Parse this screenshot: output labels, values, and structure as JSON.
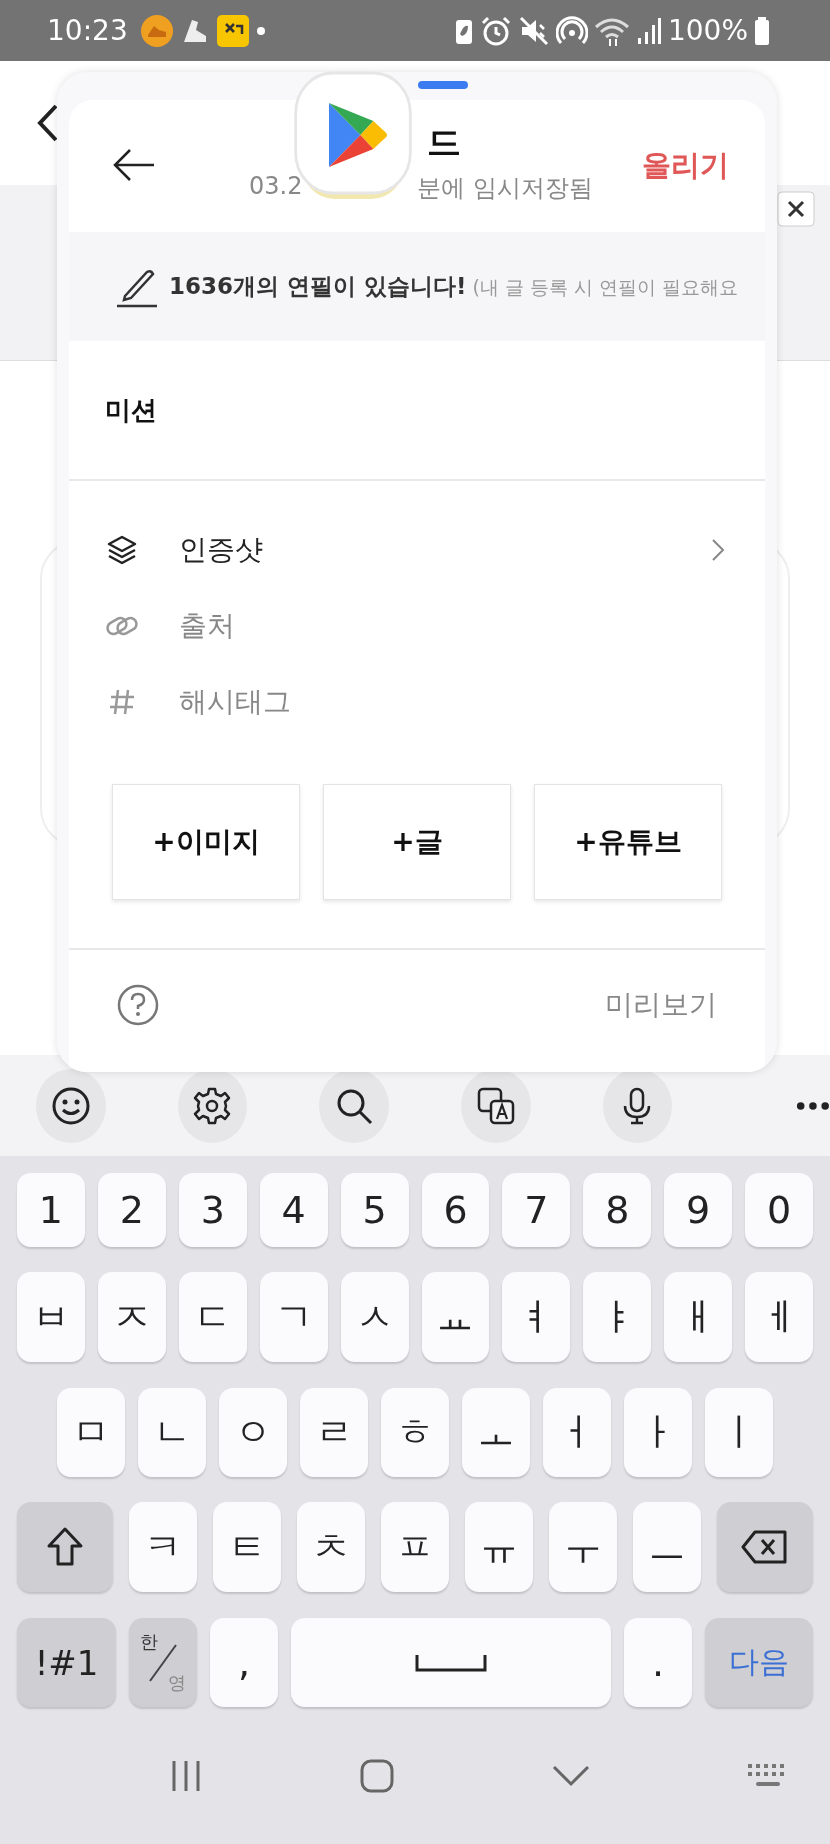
{
  "status_bar": {
    "time": "10:23",
    "battery": "100%"
  },
  "editor": {
    "title": "드",
    "saved_parts": [
      "03.2",
      "분에 임시저장됨"
    ],
    "submit": "올리기",
    "notice": "**1636개의 연필이 있습니다!** (내 글 등록 시 연필이 필요해요",
    "mission_label": "미션",
    "rows": [
      {
        "kind": "link",
        "label": "인증샷"
      },
      {
        "kind": "input",
        "label": "출처"
      },
      {
        "kind": "input",
        "label": "해시태그"
      }
    ],
    "add_buttons": [
      "+이미지",
      "+글",
      "+유튜브"
    ],
    "preview": "미리보기"
  },
  "keyboard": {
    "rows": [
      {
        "keys": [
          {
            "kind": "char",
            "label": "1"
          },
          {
            "kind": "char",
            "label": "2"
          },
          {
            "kind": "char",
            "label": "3"
          },
          {
            "kind": "char",
            "label": "4"
          },
          {
            "kind": "char",
            "label": "5"
          },
          {
            "kind": "char",
            "label": "6"
          },
          {
            "kind": "char",
            "label": "7"
          },
          {
            "kind": "char",
            "label": "8"
          },
          {
            "kind": "char",
            "label": "9"
          },
          {
            "kind": "char",
            "label": "0"
          }
        ]
      },
      {
        "keys": [
          {
            "kind": "char",
            "label": "ㅂ"
          },
          {
            "kind": "char",
            "label": "ㅈ"
          },
          {
            "kind": "char",
            "label": "ㄷ"
          },
          {
            "kind": "char",
            "label": "ㄱ"
          },
          {
            "kind": "char",
            "label": "ㅅ"
          },
          {
            "kind": "char",
            "label": "ㅛ"
          },
          {
            "kind": "char",
            "label": "ㅕ"
          },
          {
            "kind": "char",
            "label": "ㅑ"
          },
          {
            "kind": "char",
            "label": "ㅐ"
          },
          {
            "kind": "char",
            "label": "ㅔ"
          }
        ]
      },
      {
        "keys": [
          {
            "kind": "char",
            "label": "ㅁ"
          },
          {
            "kind": "char",
            "label": "ㄴ"
          },
          {
            "kind": "char",
            "label": "ㅇ"
          },
          {
            "kind": "char",
            "label": "ㄹ"
          },
          {
            "kind": "char",
            "label": "ㅎ"
          },
          {
            "kind": "char",
            "label": "ㅗ"
          },
          {
            "kind": "char",
            "label": "ㅓ"
          },
          {
            "kind": "char",
            "label": "ㅏ"
          },
          {
            "kind": "char",
            "label": "ㅣ"
          }
        ]
      },
      {
        "keys": [
          {
            "kind": "shift"
          },
          {
            "kind": "char",
            "label": "ㅋ"
          },
          {
            "kind": "char",
            "label": "ㅌ"
          },
          {
            "kind": "char",
            "label": "ㅊ"
          },
          {
            "kind": "char",
            "label": "ㅍ"
          },
          {
            "kind": "char",
            "label": "ㅠ"
          },
          {
            "kind": "char",
            "label": "ㅜ"
          },
          {
            "kind": "char",
            "label": "ㅡ"
          },
          {
            "kind": "backspace"
          }
        ]
      },
      {
        "keys": [
          {
            "kind": "symbols",
            "label": "!#1"
          },
          {
            "kind": "lang",
            "labels": [
              "한",
              "영"
            ]
          },
          {
            "kind": "char",
            "label": ","
          },
          {
            "kind": "space"
          },
          {
            "kind": "char",
            "label": "."
          },
          {
            "kind": "action",
            "label": "다음"
          }
        ]
      }
    ]
  }
}
